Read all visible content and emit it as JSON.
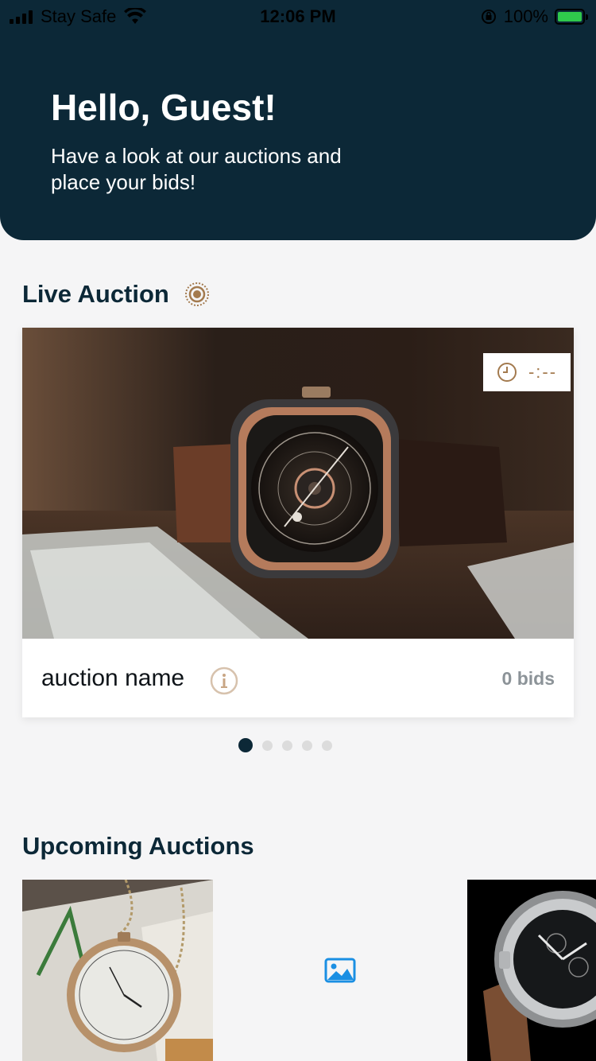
{
  "status_bar": {
    "carrier": "Stay Safe",
    "time": "12:06 PM",
    "battery": "100%"
  },
  "header": {
    "greeting": "Hello, Guest!",
    "subtitle": "Have a look at our auctions and place your bids!"
  },
  "live": {
    "title": "Live Auction",
    "timer": "-:--",
    "auction_name": "auction name",
    "bids": "0 bids",
    "carousel_pages": 5,
    "active_page": 1
  },
  "upcoming": {
    "title": "Upcoming Auctions"
  },
  "colors": {
    "primary": "#0c2837",
    "accent": "#a37a4e",
    "background": "#f5f5f6",
    "placeholder_icon": "#1a8fe3"
  },
  "icons": [
    "wifi-icon",
    "live-broadcast-icon",
    "clock-icon",
    "info-icon",
    "image-placeholder-icon"
  ]
}
